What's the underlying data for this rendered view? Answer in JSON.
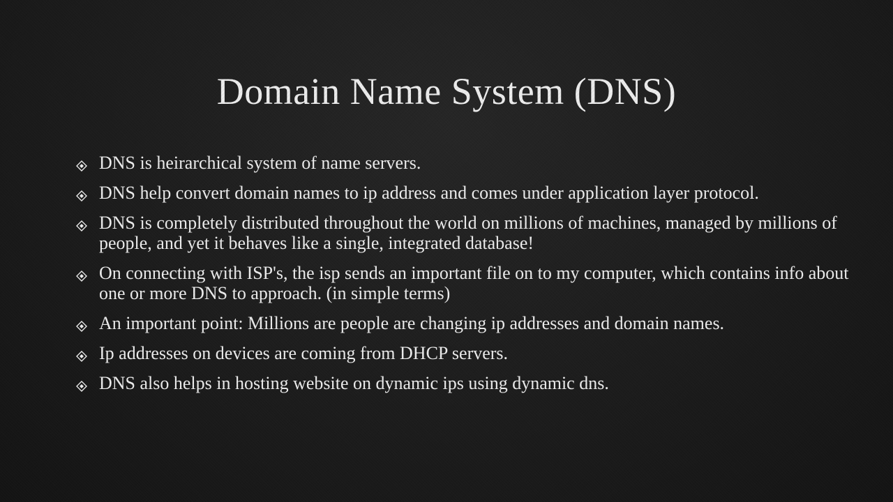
{
  "slide": {
    "title": "Domain Name System (DNS)",
    "bullet_icon": "diamond-bullet-icon",
    "bullets": [
      {
        "text": "DNS is heirarchical system of name servers."
      },
      {
        "text": "DNS help convert domain names to ip address and comes under application layer protocol."
      },
      {
        "text": "DNS is completely distributed throughout the world on millions of machines, managed by millions of people, and yet it behaves like a single, integrated database!"
      },
      {
        "text": "On connecting with ISP's, the isp sends an important file on to my computer, which contains info about one or more DNS to approach. (in simple terms)"
      },
      {
        "text": "An important point: Millions are people are changing ip addresses and domain names."
      },
      {
        "text": "Ip addresses on devices are coming from DHCP servers."
      },
      {
        "text": "DNS also helps in hosting website on dynamic ips using dynamic dns."
      }
    ],
    "colors": {
      "background": "#1c1c1c",
      "text": "#ececec"
    }
  }
}
